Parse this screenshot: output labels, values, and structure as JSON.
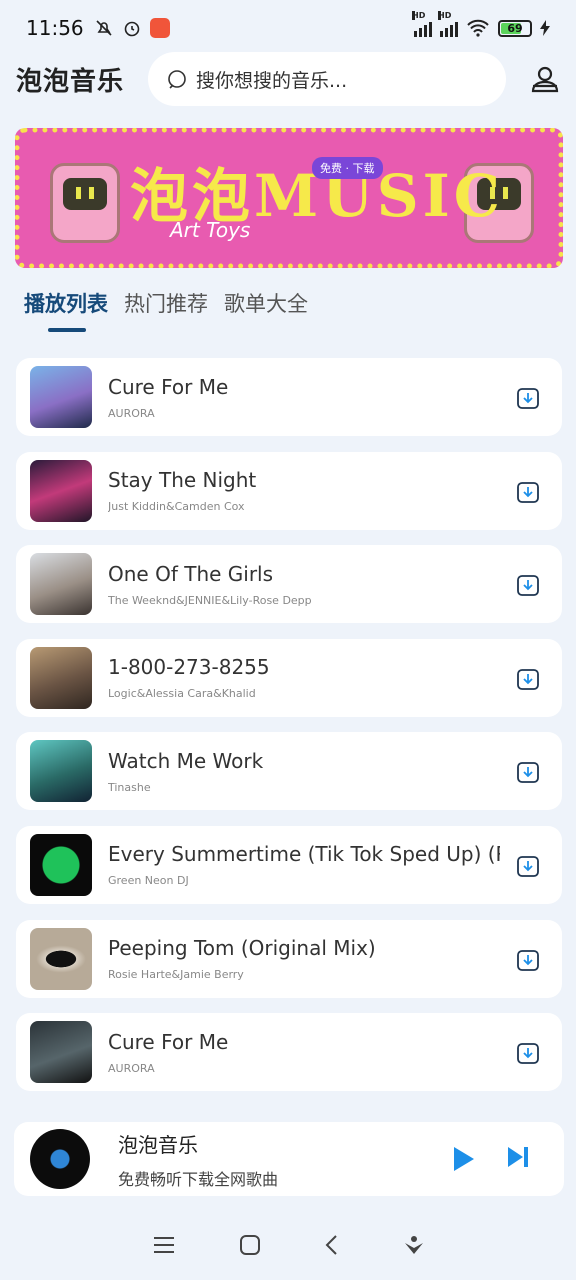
{
  "status": {
    "time": "11:56",
    "battery": "69"
  },
  "header": {
    "title": "泡泡音乐",
    "search_placeholder": "搜你想搜的音乐..."
  },
  "banner": {
    "title": "泡泡MUSIC",
    "subtitle": "Art Toys",
    "tag": "免费 · 下载"
  },
  "tabs": [
    {
      "label": "播放列表",
      "active": true
    },
    {
      "label": "热门推荐",
      "active": false
    },
    {
      "label": "歌单大全",
      "active": false
    }
  ],
  "songs": [
    {
      "title": "Cure For Me",
      "artist": "AURORA"
    },
    {
      "title": "Stay The Night",
      "artist": "Just Kiddin&Camden Cox"
    },
    {
      "title": "One Of The Girls",
      "artist": "The Weeknd&JENNIE&Lily-Rose Depp"
    },
    {
      "title": "1-800-273-8255",
      "artist": "Logic&Alessia Cara&Khalid"
    },
    {
      "title": "Watch Me Work",
      "artist": "Tinashe"
    },
    {
      "title": "Every Summertime (Tik Tok Sped Up) (Re",
      "artist": "Green Neon DJ"
    },
    {
      "title": "Peeping Tom (Original Mix)",
      "artist": "Rosie Harte&Jamie Berry"
    },
    {
      "title": "Cure For Me",
      "artist": "AURORA"
    }
  ],
  "player": {
    "title": "泡泡音乐",
    "subtitle": "免费畅听下载全网歌曲"
  },
  "colors": {
    "accent": "#164a7a",
    "play": "#1d8fe8",
    "banner": "#e85bb0"
  }
}
